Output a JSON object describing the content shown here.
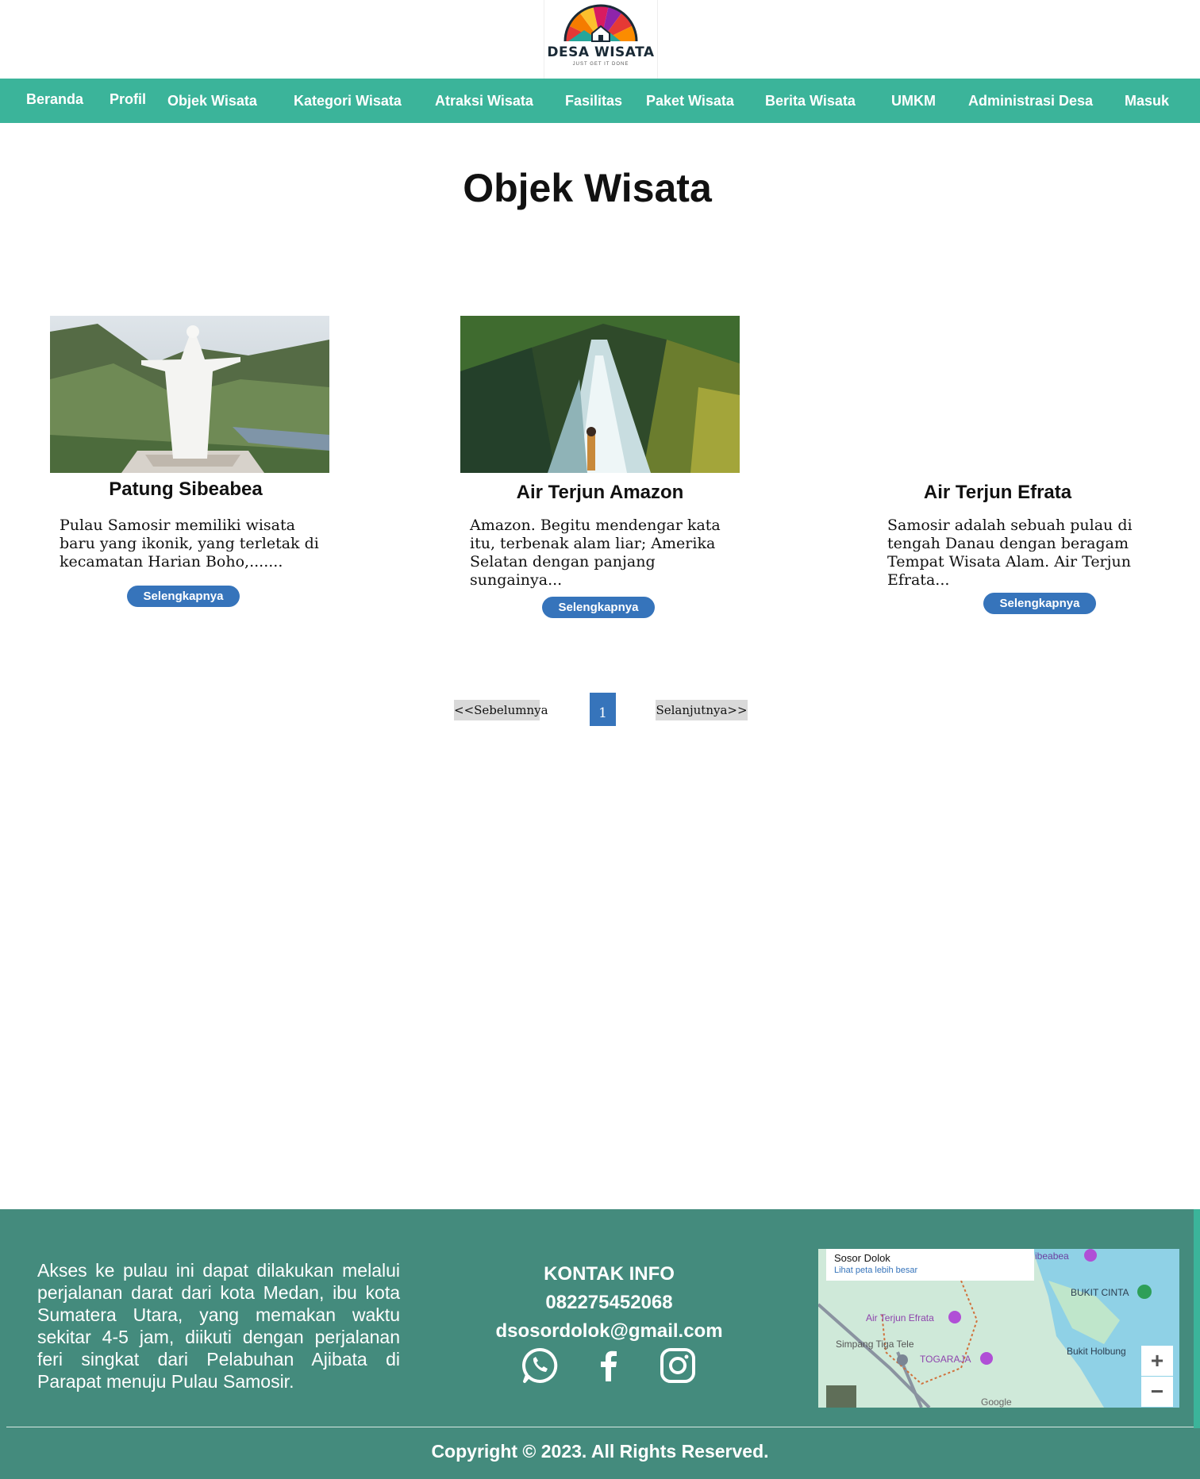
{
  "brand": {
    "name": "DESA WISATA",
    "tagline": "JUST GET IT DONE"
  },
  "nav": {
    "items": [
      "Beranda",
      "Profil",
      "Objek Wisata",
      "Kategori Wisata",
      "Atraksi Wisata",
      "Fasilitas",
      "Paket Wisata",
      "Berita Wisata",
      "UMKM",
      "Administrasi Desa",
      "Masuk"
    ]
  },
  "page": {
    "title": "Objek Wisata"
  },
  "cards": [
    {
      "title": "Patung Sibeabea",
      "desc_lines": [
        "Pulau Samosir memiliki wisata",
        "baru yang ikonik, yang terletak di",
        "kecamatan Harian Boho,......."
      ],
      "button": "Selengkapnya",
      "image": "statue-photo"
    },
    {
      "title": "Air Terjun Amazon",
      "desc_lines": [
        "Amazon. Begitu mendengar kata",
        "itu, terbenak alam liar; Amerika",
        "Selatan dengan panjang",
        "sungainya..."
      ],
      "button": "Selengkapnya",
      "image": "waterfall-photo"
    },
    {
      "title": "Air Terjun Efrata",
      "desc_lines": [
        "Samosir adalah sebuah pulau di",
        "tengah Danau dengan beragam",
        "Tempat Wisata Alam. Air Terjun",
        "Efrata..."
      ],
      "button": "Selengkapnya",
      "image": ""
    }
  ],
  "pagination": {
    "prev": "<<Sebelumnya",
    "current": "1",
    "next": "Selanjutnya>>"
  },
  "footer": {
    "about": "Akses ke pulau ini dapat dilakukan melalui perjalanan darat dari kota Medan, ibu kota Sumatera Utara, yang memakan waktu sekitar 4-5 jam, diikuti dengan perjalanan feri singkat dari Pelabuhan Ajibata di Parapat menuju Pulau Samosir.",
    "contact_title": "KONTAK INFO",
    "phone": "082275452068",
    "email": "dsosordolok@gmail.com",
    "social": [
      "whatsapp-icon",
      "facebook-icon",
      "instagram-icon"
    ],
    "map": {
      "place": "Sosor Dolok",
      "link": "Lihat peta lebih besar",
      "labels": [
        "ibeabea",
        "BUKIT CINTA",
        "Air Terjun Efrata",
        "Simpang Tiga Tele",
        "TOGARAJA",
        "Bukit Holbung",
        "Google"
      ],
      "zoom_in": "+",
      "zoom_out": "−"
    },
    "copyright": "Copyright © 2023. All Rights Reserved."
  },
  "colors": {
    "nav": "#3bb49a",
    "button": "#3674bb",
    "footer": "#448b7d"
  }
}
